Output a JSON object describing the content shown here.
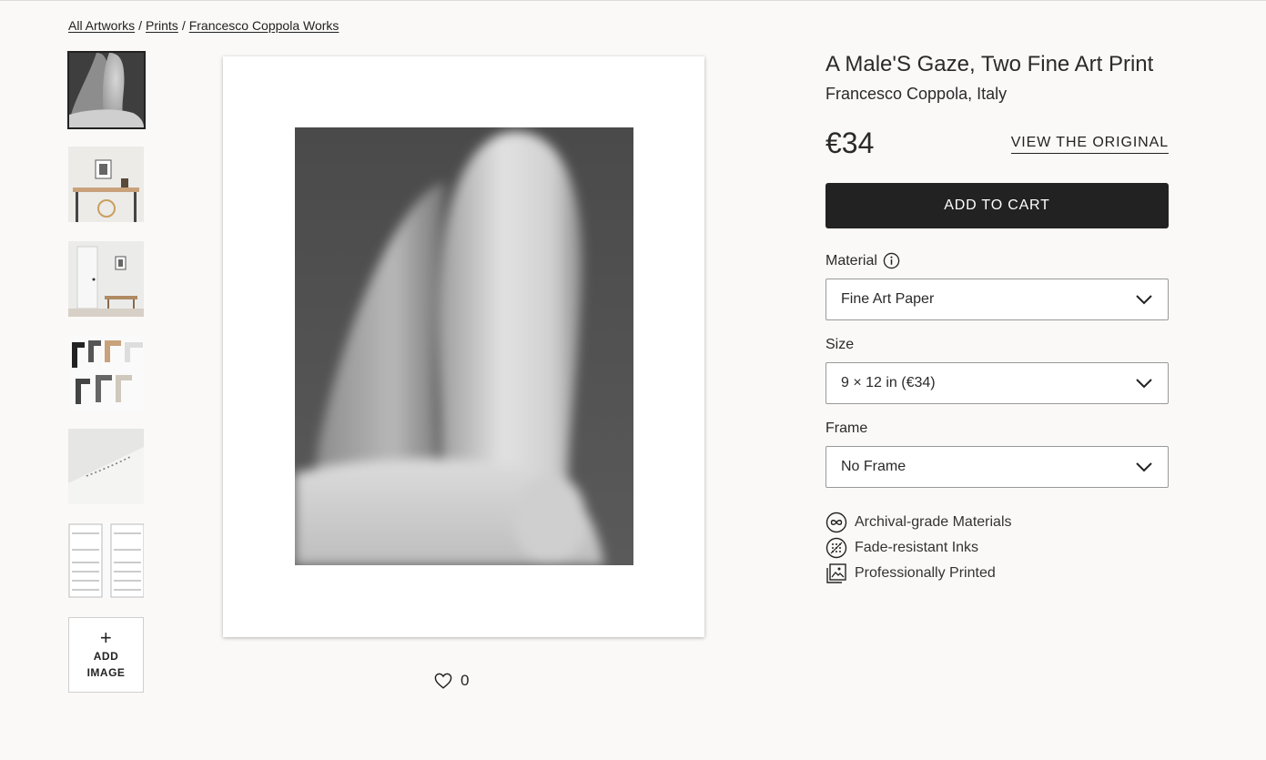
{
  "breadcrumb": {
    "items": [
      "All Artworks",
      "Prints",
      "Francesco Coppola Works"
    ],
    "separator": "/"
  },
  "thumbnails": {
    "add_image_plus": "+",
    "add_image_line1": "ADD",
    "add_image_line2": "IMAGE"
  },
  "likes": {
    "count": "0"
  },
  "product": {
    "title": "A Male'S Gaze, Two Fine Art Print",
    "artist": "Francesco Coppola, Italy",
    "price": "€34",
    "view_original": "VIEW THE ORIGINAL",
    "add_to_cart": "ADD TO CART"
  },
  "options": {
    "material_label": "Material",
    "material_value": "Fine Art Paper",
    "size_label": "Size",
    "size_value": "9 × 12 in (€34)",
    "frame_label": "Frame",
    "frame_value": "No Frame"
  },
  "features": [
    {
      "icon": "infinity-icon",
      "label": "Archival-grade Materials"
    },
    {
      "icon": "ink-dots-icon",
      "label": "Fade-resistant Inks"
    },
    {
      "icon": "print-stack-icon",
      "label": "Professionally Printed"
    }
  ],
  "colors": {
    "background": "#faf9f7",
    "button": "#222222",
    "text": "#222222"
  }
}
